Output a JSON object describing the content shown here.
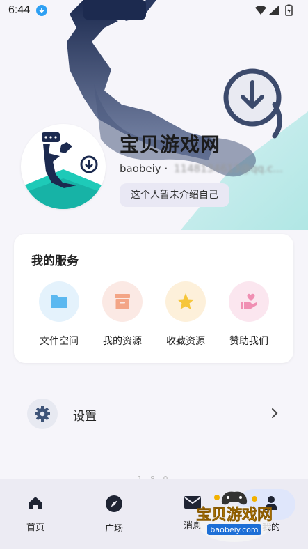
{
  "status_bar": {
    "time": "6:44"
  },
  "profile": {
    "name": "宝贝游戏网",
    "account_prefix": "baobeiy ·",
    "account_blurred": "1148134613@qq.c...",
    "bio": "这个人暂未介绍自己"
  },
  "services": {
    "title": "我的服务",
    "items": [
      {
        "label": "文件空间",
        "icon": "folder-icon",
        "color": "#5bb8f0"
      },
      {
        "label": "我的资源",
        "icon": "archive-box-icon",
        "color": "#f3a586"
      },
      {
        "label": "收藏资源",
        "icon": "star-icon",
        "color": "#f6c63a"
      },
      {
        "label": "赞助我们",
        "icon": "heart-hand-icon",
        "color": "#f08fb3"
      }
    ]
  },
  "settings": {
    "label": "设置"
  },
  "version": "1.8.0",
  "tabs": [
    {
      "label": "首页",
      "icon": "home-icon"
    },
    {
      "label": "广场",
      "icon": "compass-icon"
    },
    {
      "label": "消息",
      "icon": "mail-icon"
    },
    {
      "label": "我的",
      "icon": "person-icon",
      "active": true
    }
  ],
  "watermark": {
    "title": "宝贝游戏网",
    "url": "baobeiy.com"
  },
  "colors": {
    "accent_teal": "#1fc4b7",
    "navy": "#1c2a4f",
    "download_blue": "#2ea0f3"
  }
}
